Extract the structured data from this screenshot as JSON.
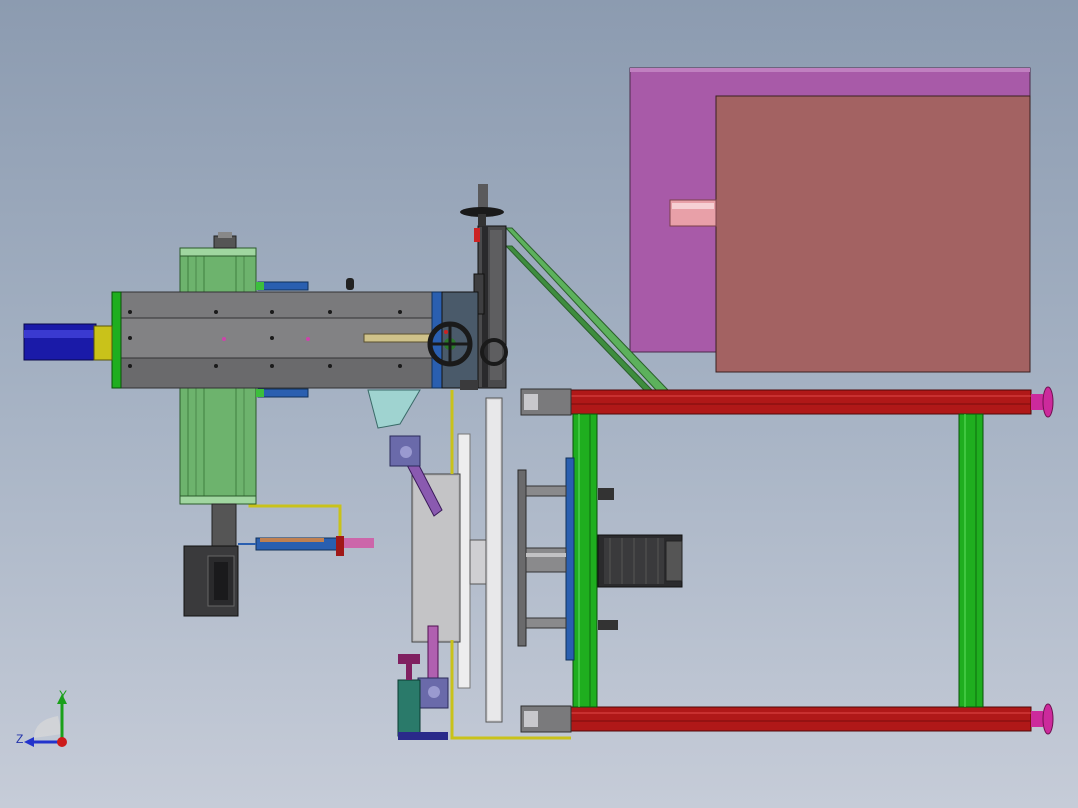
{
  "axes": {
    "y_label": "Y",
    "z_label": "Z"
  },
  "colors": {
    "background_top": "#8c9bb0",
    "background_bottom": "#c6ccd8",
    "frame_red": "#b01818",
    "frame_green": "#1fae1f",
    "motor_blue": "#1a1aa8",
    "housing_purple": "#a85aa8",
    "housing_brown": "#a36262",
    "carriage_gray": "#6e6e70",
    "rail_yellow": "#c9c21a",
    "cylinder_green": "#6db36d",
    "foot_magenta": "#cc2a9c"
  }
}
